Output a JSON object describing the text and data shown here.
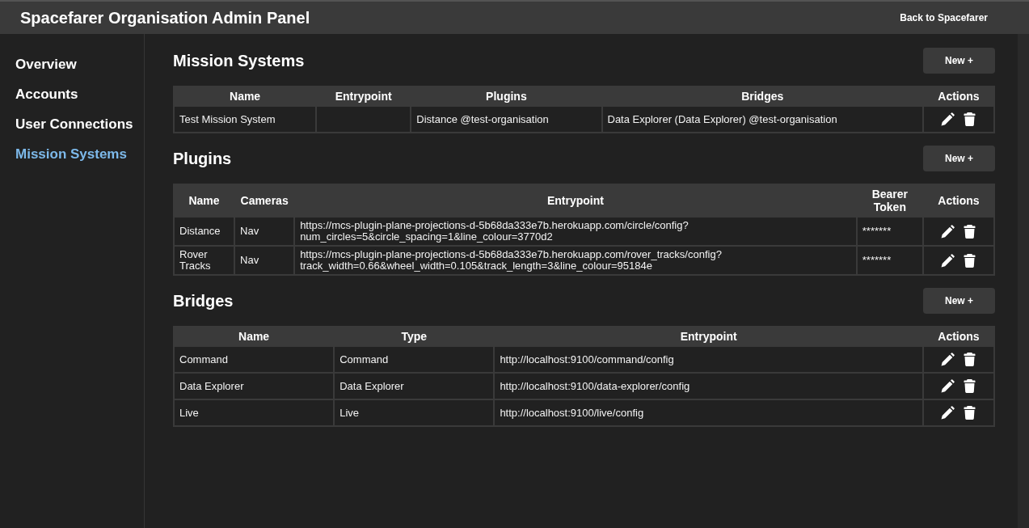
{
  "header": {
    "title": "Spacefarer Organisation Admin Panel",
    "back_link": "Back to Spacefarer"
  },
  "sidebar": {
    "items": [
      {
        "label": "Overview",
        "selected": false
      },
      {
        "label": "Accounts",
        "selected": false
      },
      {
        "label": "User Connections",
        "selected": false
      },
      {
        "label": "Mission Systems",
        "selected": true
      }
    ]
  },
  "sections": [
    {
      "title": "Mission Systems",
      "new_button": "New +",
      "table": {
        "columns": [
          {
            "label": "Name",
            "kind": "text"
          },
          {
            "label": "Entrypoint",
            "kind": "text"
          },
          {
            "label": "Plugins",
            "kind": "text"
          },
          {
            "label": "Bridges",
            "kind": "text"
          },
          {
            "label": "Actions",
            "kind": "actions"
          }
        ],
        "rows": [
          {
            "cells": [
              "Test Mission System",
              null,
              "Distance @test-organisation",
              "Data Explorer (Data Explorer) @test-organisation"
            ]
          }
        ]
      }
    },
    {
      "title": "Plugins",
      "new_button": "New +",
      "table": {
        "columns": [
          {
            "label": "Name",
            "kind": "text"
          },
          {
            "label": "Cameras",
            "kind": "text"
          },
          {
            "label": "Entrypoint",
            "kind": "text"
          },
          {
            "label": "Bearer Token",
            "kind": "text"
          },
          {
            "label": "Actions",
            "kind": "actions"
          }
        ],
        "rows": [
          {
            "cells": [
              "Distance",
              "Nav",
              "https://mcs-plugin-plane-projections-d-5b68da333e7b.herokuapp.com/circle/config?num_circles=5&circle_spacing=1&line_colour=3770d2",
              "*******"
            ]
          },
          {
            "cells": [
              "Rover Tracks",
              "Nav",
              "https://mcs-plugin-plane-projections-d-5b68da333e7b.herokuapp.com/rover_tracks/config?track_width=0.66&wheel_width=0.105&track_length=3&line_colour=95184e",
              "*******"
            ]
          }
        ]
      }
    },
    {
      "title": "Bridges",
      "new_button": "New +",
      "table": {
        "columns": [
          {
            "label": "Name",
            "kind": "text"
          },
          {
            "label": "Type",
            "kind": "text"
          },
          {
            "label": "Entrypoint",
            "kind": "text"
          },
          {
            "label": "Actions",
            "kind": "actions"
          }
        ],
        "rows": [
          {
            "cells": [
              "Command",
              "Command",
              "http://localhost:9100/command/config"
            ]
          },
          {
            "cells": [
              "Data Explorer",
              "Data Explorer",
              "http://localhost:9100/data-explorer/config"
            ]
          },
          {
            "cells": [
              "Live",
              "Live",
              "http://localhost:9100/live/config"
            ]
          }
        ]
      }
    }
  ]
}
